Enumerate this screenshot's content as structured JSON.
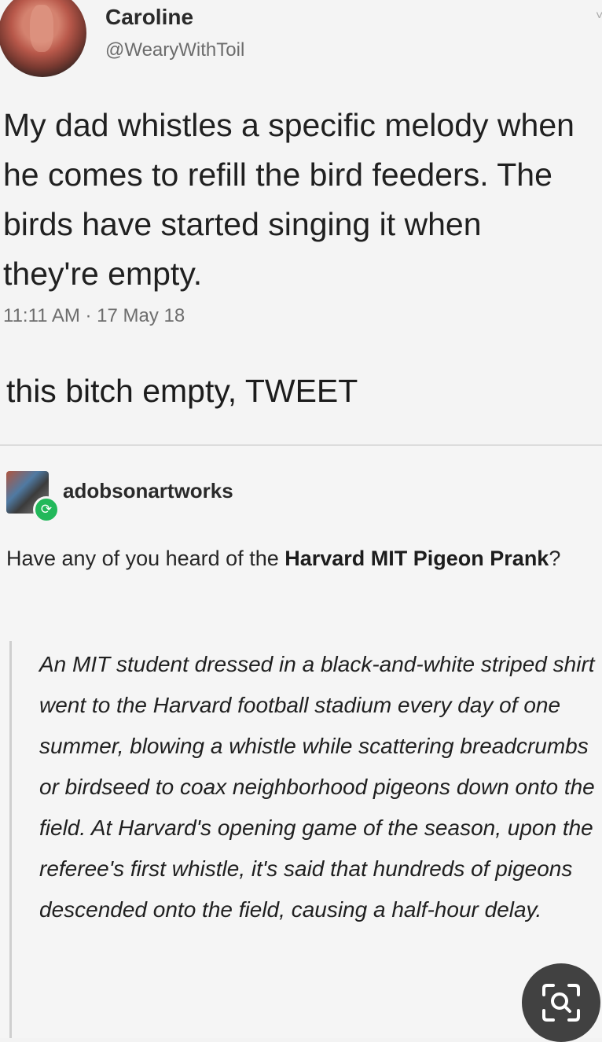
{
  "tweet": {
    "name": "Caroline",
    "handle": "@WearyWithToil",
    "text": "My dad whistles a specific melody when he comes to refill the bird feeders. The birds have started singing it when they're empty.",
    "timestamp": "11:11 AM · 17 May 18"
  },
  "caption": "this bitch empty, TWEET",
  "post": {
    "username": "adobsonartworks",
    "intro_plain": "Have any of you heard of the ",
    "intro_bold": "Harvard MIT Pigeon Prank",
    "intro_end": "?",
    "quote": "An MIT student dressed in a black-and-white striped shirt went to the Harvard football stadium every day of one summer, blowing a whistle while scattering breadcrumbs or birdseed to coax neighborhood pigeons down onto the field. At Harvard's opening game of the season, upon the referee's first whistle, it's said that hundreds of pigeons descended onto the field, causing a half-hour delay."
  },
  "icons": {
    "avatar": "profile-photo",
    "reblog": "reblog-icon",
    "lens": "visual-search-icon"
  }
}
